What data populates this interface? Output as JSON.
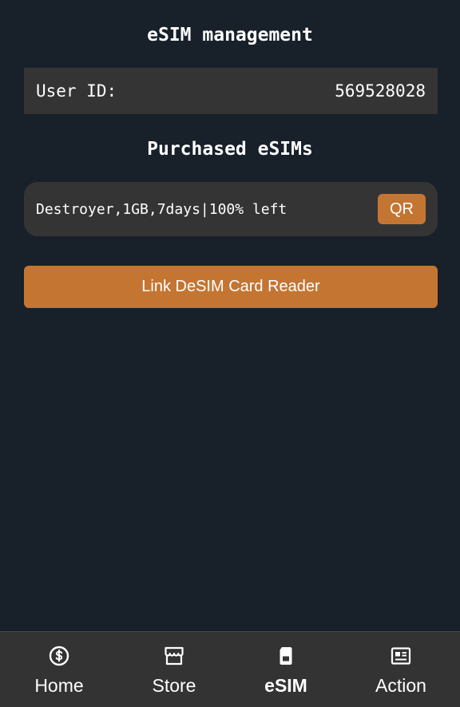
{
  "header": {
    "title": "eSIM management"
  },
  "user": {
    "label": "User ID:",
    "value": "569528028"
  },
  "purchased": {
    "title": "Purchased eSIMs",
    "items": [
      {
        "text": "Destroyer,1GB,7days|100% left",
        "qr_label": "QR"
      }
    ]
  },
  "actions": {
    "link_reader_label": "Link DeSIM Card Reader"
  },
  "nav": {
    "items": [
      {
        "label": "Home",
        "icon": "dollar-coin-icon",
        "active": false
      },
      {
        "label": "Store",
        "icon": "storefront-icon",
        "active": false
      },
      {
        "label": "eSIM",
        "icon": "sim-card-icon",
        "active": true
      },
      {
        "label": "Action",
        "icon": "newspaper-icon",
        "active": false
      }
    ]
  },
  "colors": {
    "background": "#18202a",
    "panel": "#343434",
    "accent": "#c47532",
    "nav_background": "#333333"
  }
}
